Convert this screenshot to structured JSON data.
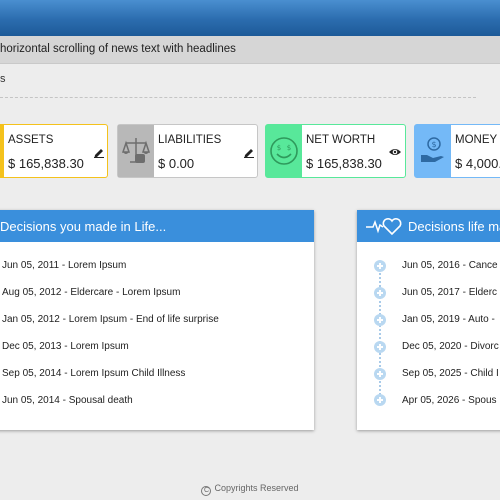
{
  "ticker": {
    "text": "horizontal scrolling of news text with headlines"
  },
  "subnav": {
    "label": "s"
  },
  "cards": [
    {
      "title": "ASSETS",
      "value": "$ 165,838.30",
      "action": "edit-icon",
      "accent": "#f4c21c"
    },
    {
      "title": "LIABILITIES",
      "value": "$ 0.00",
      "action": "edit-icon",
      "accent": "#b8b8b8"
    },
    {
      "title": "NET WORTH",
      "value": "$ 165,838.30",
      "action": "eye-icon",
      "accent": "#58e89a"
    },
    {
      "title": "MONEY I",
      "value": "$ 4,000.",
      "action": "",
      "accent": "#74b9f7"
    }
  ],
  "left_panel": {
    "title": "Decisions you made in Life...",
    "items": [
      "Jun 05, 2011 - Lorem Ipsum",
      "Aug 05, 2012 - Eldercare - Lorem Ipsum",
      "Jan 05, 2012 - Lorem Ipsum - End of life surprise",
      "Dec 05, 2013 - Lorem Ipsum",
      "Sep 05, 2014 - Lorem Ipsum Child Illness",
      "Jun 05,  2014 - Spousal death"
    ]
  },
  "right_panel": {
    "title": "Decisions life ma",
    "items": [
      "Jun 05, 2016 - Cance",
      "Jun 05, 2017 - Elderc",
      "Jan 05, 2019 - Auto -",
      "Dec 05, 2020 - Divorc",
      "Sep 05, 2025 - Child I",
      "Apr 05,  2026 - Spous"
    ]
  },
  "footer": {
    "text": "Copyrights Reserved",
    "symbol": "C"
  }
}
